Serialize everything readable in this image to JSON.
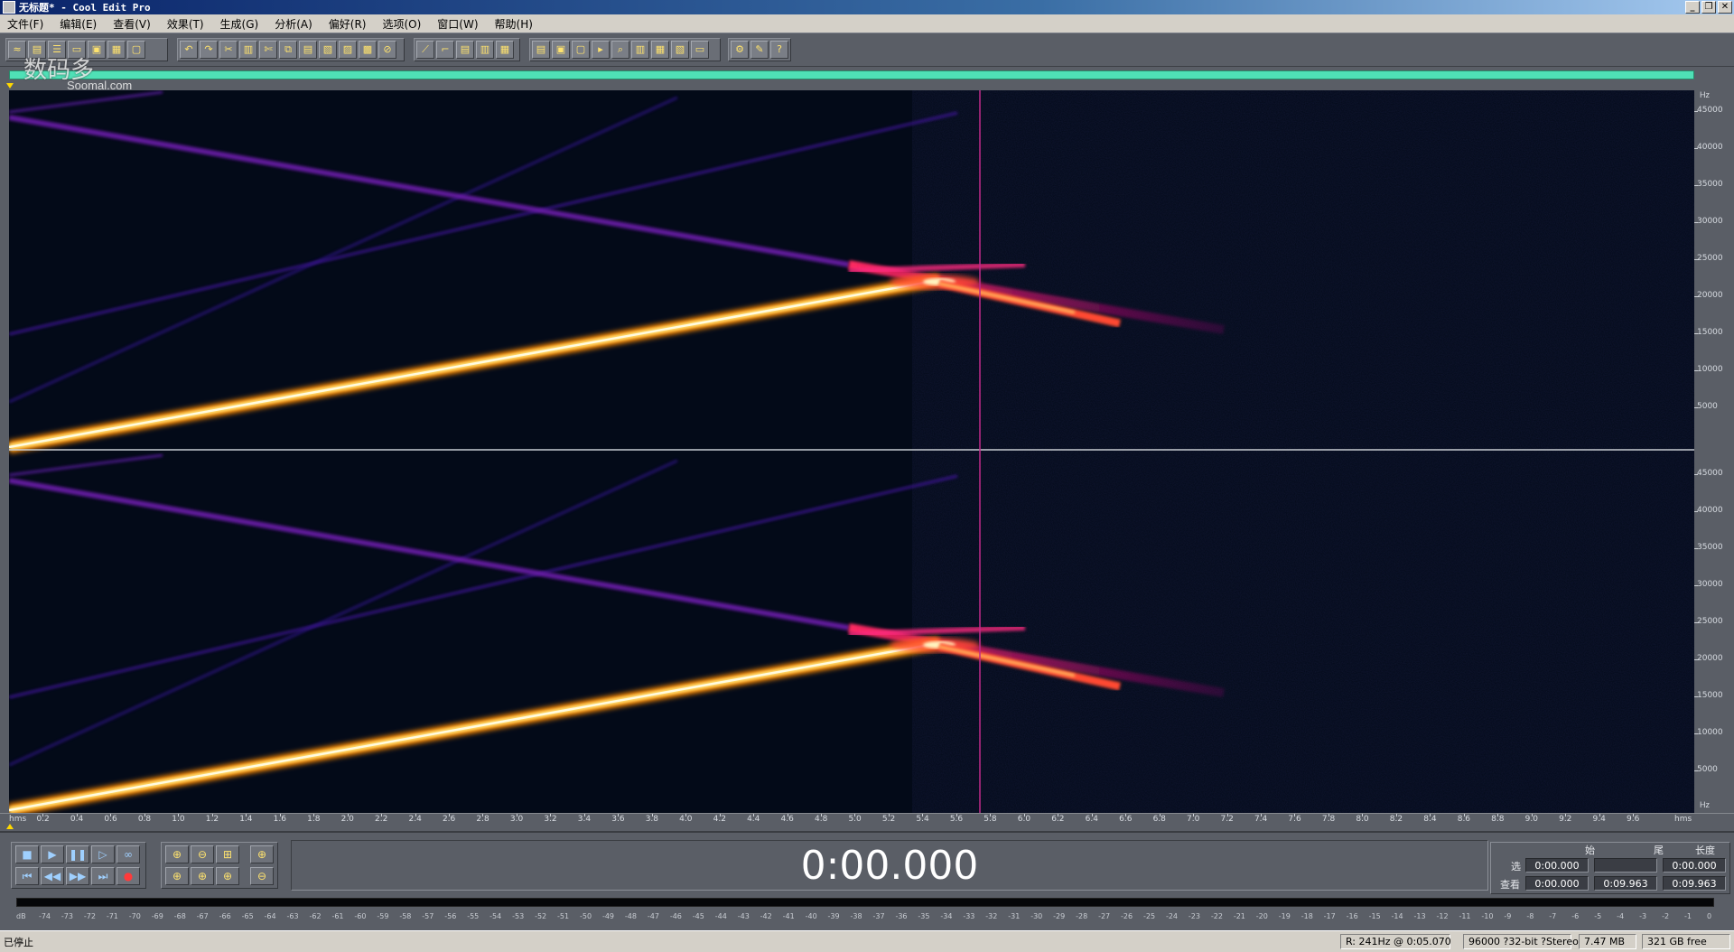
{
  "window": {
    "title": "无标题* - Cool Edit Pro",
    "minimize_glyph": "_",
    "restore_glyph": "❐",
    "close_glyph": "✕"
  },
  "watermark": {
    "text": "数码多",
    "sub": "Soomal.com"
  },
  "menu": [
    "文件(F)",
    "编辑(E)",
    "查看(V)",
    "效果(T)",
    "生成(G)",
    "分析(A)",
    "偏好(R)",
    "选项(O)",
    "窗口(W)",
    "帮助(H)"
  ],
  "freq_axis": {
    "unit": "Hz",
    "labels": [
      "45000",
      "40000",
      "35000",
      "30000",
      "25000",
      "20000",
      "15000",
      "10000",
      "5000"
    ]
  },
  "time_ruler": {
    "unit_start": "hms",
    "unit_end": "hms",
    "labels": [
      "0.2",
      "0.4",
      "0.6",
      "0.8",
      "1.0",
      "1.2",
      "1.4",
      "1.6",
      "1.8",
      "2.0",
      "2.2",
      "2.4",
      "2.6",
      "2.8",
      "3.0",
      "3.2",
      "3.4",
      "3.6",
      "3.8",
      "4.0",
      "4.2",
      "4.4",
      "4.6",
      "4.8",
      "5.0",
      "5.2",
      "5.4",
      "5.6",
      "5.8",
      "6.0",
      "6.2",
      "6.4",
      "6.6",
      "6.8",
      "7.0",
      "7.2",
      "7.4",
      "7.6",
      "7.8",
      "8.0",
      "8.2",
      "8.4",
      "8.6",
      "8.8",
      "9.0",
      "9.2",
      "9.4",
      "9.6"
    ]
  },
  "transport": {
    "stop": "■",
    "play": "▶",
    "pause": "❚❚",
    "play_to_end": "▷",
    "loop": "∞",
    "go_start": "⏮",
    "rewind": "◀◀",
    "forward": "▶▶",
    "go_end": "⏭",
    "record": "●",
    "zoom_in_h": "⊕",
    "zoom_out_h": "⊖",
    "zoom_full": "⊞",
    "zoom_in_v": "⊕",
    "zoom_left": "⊕",
    "zoom_right": "⊕",
    "zoom_sel": "⊕",
    "zoom_out_v": "⊖"
  },
  "time_display": "0:00.000",
  "selection": {
    "headers": {
      "start": "始",
      "end": "尾",
      "length": "长度"
    },
    "rows": [
      {
        "label": "选",
        "start": "0:00.000",
        "end": "",
        "length": "0:00.000"
      },
      {
        "label": "查看",
        "start": "0:00.000",
        "end": "0:09.963",
        "length": "0:09.963"
      }
    ]
  },
  "level_scale": [
    "dB",
    "-74",
    "-73",
    "-72",
    "-71",
    "-70",
    "-69",
    "-68",
    "-67",
    "-66",
    "-65",
    "-64",
    "-63",
    "-62",
    "-61",
    "-60",
    "-59",
    "-58",
    "-57",
    "-56",
    "-55",
    "-54",
    "-53",
    "-52",
    "-51",
    "-50",
    "-49",
    "-48",
    "-47",
    "-46",
    "-45",
    "-44",
    "-43",
    "-42",
    "-41",
    "-40",
    "-39",
    "-38",
    "-37",
    "-36",
    "-35",
    "-34",
    "-33",
    "-32",
    "-31",
    "-30",
    "-29",
    "-28",
    "-27",
    "-26",
    "-25",
    "-24",
    "-23",
    "-22",
    "-21",
    "-20",
    "-19",
    "-18",
    "-17",
    "-16",
    "-15",
    "-14",
    "-13",
    "-12",
    "-11",
    "-10",
    "-9",
    "-8",
    "-7",
    "-6",
    "-5",
    "-4",
    "-3",
    "-2",
    "-1",
    "0"
  ],
  "status": {
    "state": "已停止",
    "cursor": "R: 241Hz @  0:05.070",
    "format": "96000 ?32-bit ?Stereo",
    "size": "7.47 MB",
    "free": "321 GB free"
  },
  "toolbar_icons": [
    "waveform-view",
    "spectral-view",
    "open",
    "save",
    "save-all",
    "undo",
    "redo",
    "cut-tool",
    "select-tool",
    "cut",
    "copy",
    "paste",
    "mix-paste",
    "trim",
    "silence",
    "invert",
    "reverse",
    "envelope",
    "fade",
    "normalize",
    "stretch",
    "noise",
    "eq",
    "chorus",
    "delay",
    "reverb",
    "filter",
    "pitch",
    "loop",
    "info",
    "settings",
    "help"
  ],
  "colors": {
    "background": "#030a18",
    "overview": "#4fe0b6",
    "chrome": "#5a5e66",
    "accent_playhead": "#c02a8a"
  }
}
